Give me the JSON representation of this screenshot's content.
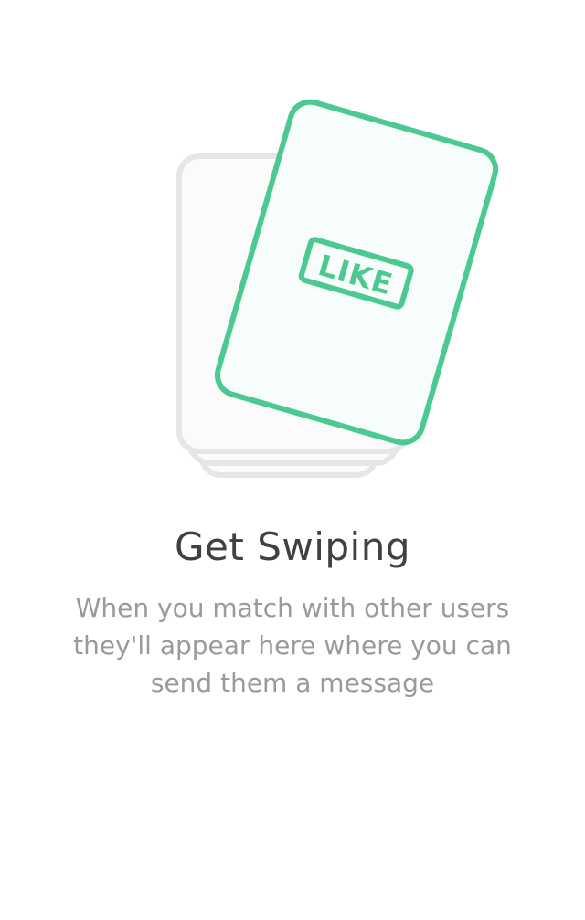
{
  "empty_state": {
    "badge_text": "LIKE",
    "title": "Get Swiping",
    "message": "When you match with other users they'll appear here where you can send them a message"
  },
  "colors": {
    "background": "#ffffff",
    "accent_green": "#4cc990",
    "card_fill": "#f6fdfa",
    "stack_gray": "#e6e6e6",
    "stack_fill": "#fbfbfb",
    "title": "#404040",
    "message": "#9a9a9a"
  },
  "icons": {
    "illustration": "card-stack-like-icon"
  }
}
